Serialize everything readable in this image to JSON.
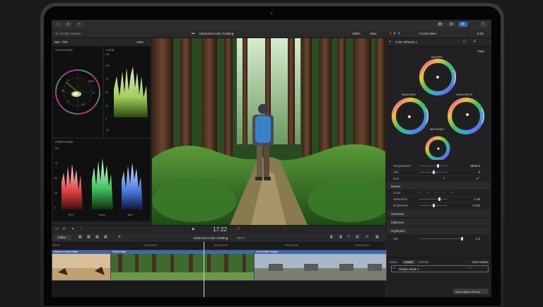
{
  "app": {
    "title": "Advanced Color Grading",
    "zoom": "100%",
    "view": "View"
  },
  "browser": {
    "project": "4K DCI8p_Names",
    "view": "View"
  },
  "scopes": {
    "colorspace": "Rec. 709",
    "vectorscope_label": "Vectorscope",
    "vectorscope_marks": [
      "MAG",
      "R",
      "YL",
      "G",
      "CY",
      "B"
    ],
    "luma_label": "Luma",
    "luma_ticks": [
      "120",
      "100",
      "75",
      "50",
      "25",
      "0",
      "-20"
    ],
    "parade_label": "RGB Parade",
    "parade_ticks": [
      "100",
      "75",
      "50",
      "25",
      "0"
    ],
    "parade_channels": [
      "Red",
      "Green",
      "Blue"
    ]
  },
  "viewer": {
    "timecode": "17:22"
  },
  "timeline": {
    "index_label": "Index",
    "title": "Advanced Color Grading",
    "duration": "09:07",
    "ruler": [
      "00:00",
      "00:00:15:00",
      "00:00:30:00",
      "00:00:45:00",
      "00:01:00:00"
    ],
    "clips": [
      {
        "name": "Horse on Sand Ridge",
        "color": "#3a68b8"
      },
      {
        "name": "Forest Hiker",
        "color": "#3a68b8"
      },
      {
        "name": "Comet BMX Wagon",
        "color": "#3a68b8"
      }
    ]
  },
  "inspector": {
    "title": "Forest Hiker",
    "duration": "6:23",
    "effect": "Color Wheels 1",
    "view": "View",
    "wheels": {
      "master": "MASTER",
      "shadows": "SHADOWS",
      "highlights": "HIGHLIGHTS",
      "midtones": "MIDTONES"
    },
    "params": [
      {
        "label": "Temperature",
        "value": "5000.0",
        "pos": 0.65
      },
      {
        "label": "Tint",
        "value": "0",
        "pos": 0.5
      },
      {
        "label": "Hue",
        "value": "0 °",
        "pos": 0.5
      }
    ],
    "sections": {
      "master": "Master",
      "shadows": "Shadows",
      "midtones": "Midtones",
      "highlights": "Highlights"
    },
    "master_params": [
      {
        "label": "Color",
        "value": ""
      },
      {
        "label": "Saturation",
        "value": "1.48",
        "pos": 0.72
      },
      {
        "label": "Brightness",
        "value": "+0.03",
        "pos": 0.52
      }
    ],
    "mix": {
      "label": "Mix",
      "value": "1.0",
      "pos": 1.0
    },
    "mask": {
      "label": "Mask:",
      "inside": "Inside",
      "outside": "Outside",
      "view_masks": "View Masks",
      "shape": "Shape Mask 1"
    },
    "save_preset": "Save Effects Preset"
  },
  "colors": {
    "accent": "#3a68b8",
    "timeline_playhead": "#d8d8d8"
  }
}
